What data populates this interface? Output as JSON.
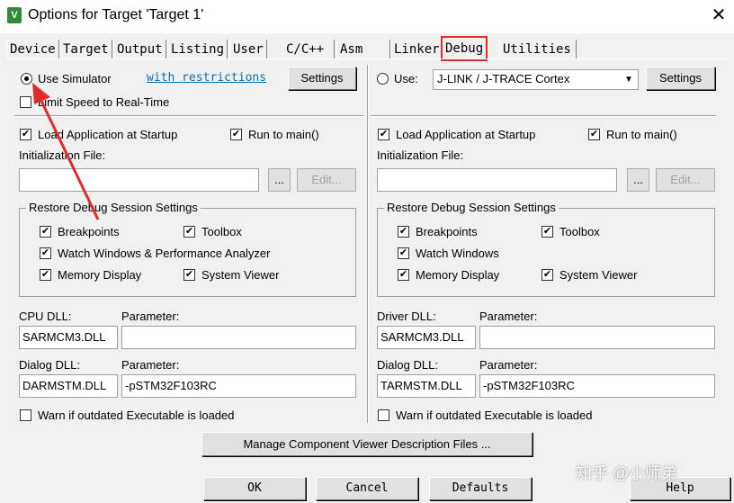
{
  "window": {
    "title": "Options for Target 'Target 1'",
    "close_glyph": "✕",
    "icon_glyph": "V"
  },
  "tabs": [
    "Device",
    "Target",
    "Output",
    "Listing",
    "User",
    "C/C++",
    "Asm",
    "Linker",
    "Debug",
    "Utilities"
  ],
  "active_tab": "Debug",
  "left": {
    "use_simulator": "Use Simulator",
    "with_restrictions": "with restrictions",
    "settings": "Settings",
    "limit_speed": "Limit Speed to Real-Time",
    "load_app": "Load Application at Startup",
    "run_to_main": "Run to main()",
    "init_file": "Initialization File:",
    "browse": "...",
    "edit": "Edit...",
    "restore_title": "Restore Debug Session Settings",
    "breakpoints": "Breakpoints",
    "toolbox": "Toolbox",
    "watch_windows": "Watch Windows & Performance Analyzer",
    "memory_display": "Memory Display",
    "system_viewer": "System Viewer",
    "cpu_dll_label": "CPU DLL:",
    "cpu_dll_value": "SARMCM3.DLL",
    "param_label": "Parameter:",
    "cpu_param_value": "",
    "dialog_dll_label": "Dialog DLL:",
    "dialog_dll_value": "DARMSTM.DLL",
    "dialog_param_value": "-pSTM32F103RC",
    "warn_outdated": "Warn if outdated Executable is loaded"
  },
  "right": {
    "use": "Use:",
    "debugger": "J-LINK / J-TRACE Cortex",
    "settings": "Settings",
    "load_app": "Load Application at Startup",
    "run_to_main": "Run to main()",
    "init_file": "Initialization File:",
    "browse": "...",
    "edit": "Edit...",
    "restore_title": "Restore Debug Session Settings",
    "breakpoints": "Breakpoints",
    "toolbox": "Toolbox",
    "watch_windows": "Watch Windows",
    "memory_display": "Memory Display",
    "system_viewer": "System Viewer",
    "driver_dll_label": "Driver DLL:",
    "driver_dll_value": "SARMCM3.DLL",
    "param_label": "Parameter:",
    "driver_param_value": "",
    "dialog_dll_label": "Dialog DLL:",
    "dialog_dll_value": "TARMSTM.DLL",
    "dialog_param_value": "-pSTM32F103RC",
    "warn_outdated": "Warn if outdated Executable is loaded"
  },
  "manage_button": "Manage Component Viewer Description Files ...",
  "footer": {
    "ok": "OK",
    "cancel": "Cancel",
    "defaults": "Defaults",
    "help": "Help"
  },
  "watermark": "知乎 @小师弟",
  "check_glyph": "✔",
  "annotation_color": "#e02b2b"
}
